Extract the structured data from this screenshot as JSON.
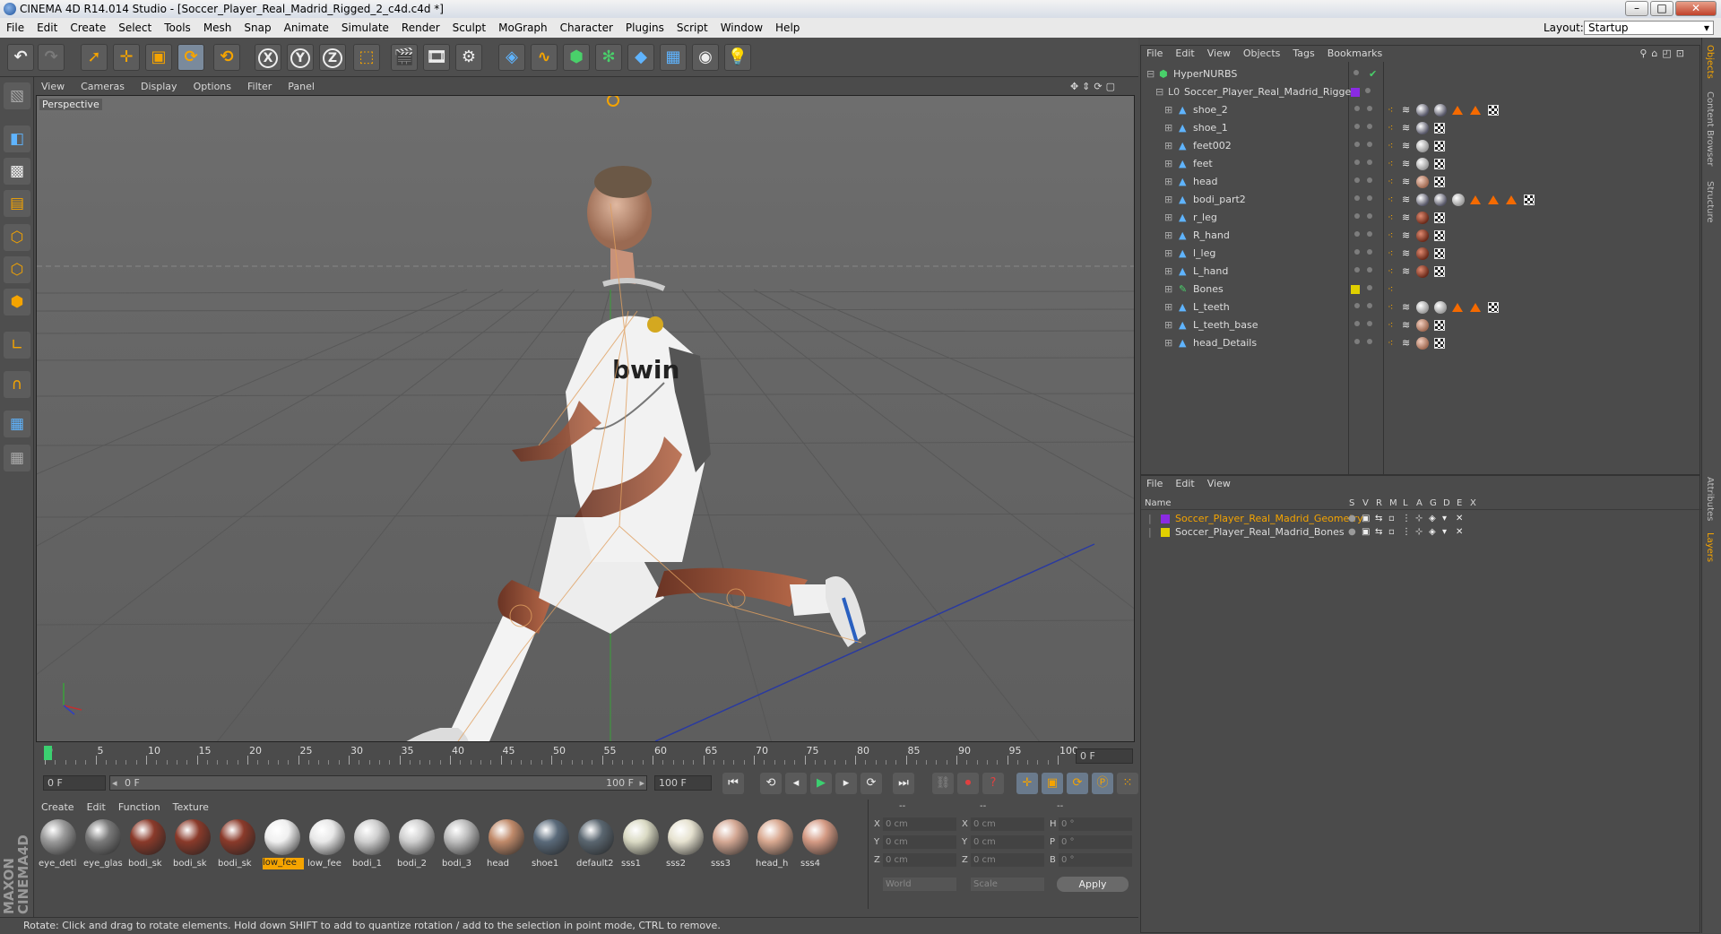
{
  "window": {
    "title": "CINEMA 4D R14.014 Studio - [Soccer_Player_Real_Madrid_Rigged_2_c4d.c4d *]"
  },
  "menu": [
    "File",
    "Edit",
    "Create",
    "Select",
    "Tools",
    "Mesh",
    "Snap",
    "Animate",
    "Simulate",
    "Render",
    "Sculpt",
    "MoGraph",
    "Character",
    "Plugins",
    "Script",
    "Window",
    "Help"
  ],
  "layout": {
    "label": "Layout:",
    "value": "Startup"
  },
  "toolbar": {
    "x_label": "X",
    "y_label": "Y",
    "z_label": "Z"
  },
  "viewport": {
    "menu": [
      "View",
      "Cameras",
      "Display",
      "Options",
      "Filter",
      "Panel"
    ],
    "label": "Perspective"
  },
  "timeline": {
    "ticks": [
      "0",
      "5",
      "10",
      "15",
      "20",
      "25",
      "30",
      "35",
      "40",
      "45",
      "50",
      "55",
      "60",
      "65",
      "70",
      "75",
      "80",
      "85",
      "90",
      "95",
      "100"
    ],
    "current_frame": "0 F"
  },
  "playbar": {
    "start": "0 F",
    "range_start": "0 F",
    "range_end": "100 F",
    "end": "100 F"
  },
  "material_manager": {
    "menu": [
      "Create",
      "Edit",
      "Function",
      "Texture"
    ],
    "materials": [
      {
        "name": "eye_deti",
        "color": "#9a9a9a"
      },
      {
        "name": "eye_glas",
        "color": "#7a7a7a"
      },
      {
        "name": "bodi_sk",
        "color": "#8a3a2a"
      },
      {
        "name": "bodi_sk",
        "color": "#8a3a2a"
      },
      {
        "name": "bodi_sk",
        "color": "#8a3a2a"
      },
      {
        "name": "low_fee",
        "color": "#f0f0f0",
        "selected": true
      },
      {
        "name": "low_fee",
        "color": "#e8e8e8"
      },
      {
        "name": "bodi_1",
        "color": "#cfcfcf"
      },
      {
        "name": "bodi_2",
        "color": "#cfcfcf"
      },
      {
        "name": "bodi_3",
        "color": "#bdbdbd"
      },
      {
        "name": "head",
        "color": "#c08a6a"
      },
      {
        "name": "shoe1",
        "color": "#5a6a7a"
      },
      {
        "name": "default2",
        "color": "#5a6670"
      },
      {
        "name": "sss1",
        "color": "#dadac4"
      },
      {
        "name": "sss2",
        "color": "#e6e2d0"
      },
      {
        "name": "sss3",
        "color": "#d4a894"
      },
      {
        "name": "head_h",
        "color": "#d8a890"
      },
      {
        "name": "sss4",
        "color": "#d49a84"
      }
    ]
  },
  "coordinates": {
    "header": [
      "--",
      "--",
      "--"
    ],
    "rows": [
      {
        "axis": "X",
        "pos": "0 cm",
        "size_axis": "X",
        "size": "0 cm",
        "rot_axis": "H",
        "rot": "0 °"
      },
      {
        "axis": "Y",
        "pos": "0 cm",
        "size_axis": "Y",
        "size": "0 cm",
        "rot_axis": "P",
        "rot": "0 °"
      },
      {
        "axis": "Z",
        "pos": "0 cm",
        "size_axis": "Z",
        "size": "0 cm",
        "rot_axis": "B",
        "rot": "0 °"
      }
    ],
    "mode1": "World",
    "mode2": "Scale",
    "apply": "Apply"
  },
  "status": "Rotate: Click and drag to rotate elements. Hold down SHIFT to add to quantize rotation / add to the selection in point mode, CTRL to remove.",
  "object_manager": {
    "menu": [
      "File",
      "Edit",
      "View",
      "Objects",
      "Tags",
      "Bookmarks"
    ],
    "root": "HyperNURBS",
    "group": "Soccer_Player_Real_Madrid_Rigged",
    "objects": [
      {
        "name": "shoe_2",
        "tags": "s2"
      },
      {
        "name": "shoe_1",
        "tags": "s1"
      },
      {
        "name": "feet002",
        "tags": "f"
      },
      {
        "name": "feet",
        "tags": "f"
      },
      {
        "name": "head",
        "tags": "h"
      },
      {
        "name": "bodi_part2",
        "tags": "b"
      },
      {
        "name": "r_leg",
        "tags": "l"
      },
      {
        "name": "R_hand",
        "tags": "l"
      },
      {
        "name": "l_leg",
        "tags": "l"
      },
      {
        "name": "L_hand",
        "tags": "l"
      },
      {
        "name": "Bones",
        "tags": "bones"
      },
      {
        "name": "L_teeth",
        "tags": "t"
      },
      {
        "name": "L_teeth_base",
        "tags": "h"
      },
      {
        "name": "head_Details",
        "tags": "h"
      }
    ]
  },
  "layer_manager": {
    "menu": [
      "File",
      "Edit",
      "View"
    ],
    "columns": [
      "Name",
      "S",
      "V",
      "R",
      "M",
      "L",
      "A",
      "G",
      "D",
      "E",
      "X"
    ],
    "layers": [
      {
        "name": "Soccer_Player_Real_Madrid_Geometry",
        "color": "#8a2be2",
        "highlight": true
      },
      {
        "name": "Soccer_Player_Real_Madrid_Bones",
        "color": "#e0d000",
        "highlight": false
      }
    ]
  },
  "side_tabs": [
    "Objects",
    "Content Browser",
    "Structure",
    "Attributes",
    "Layers"
  ]
}
